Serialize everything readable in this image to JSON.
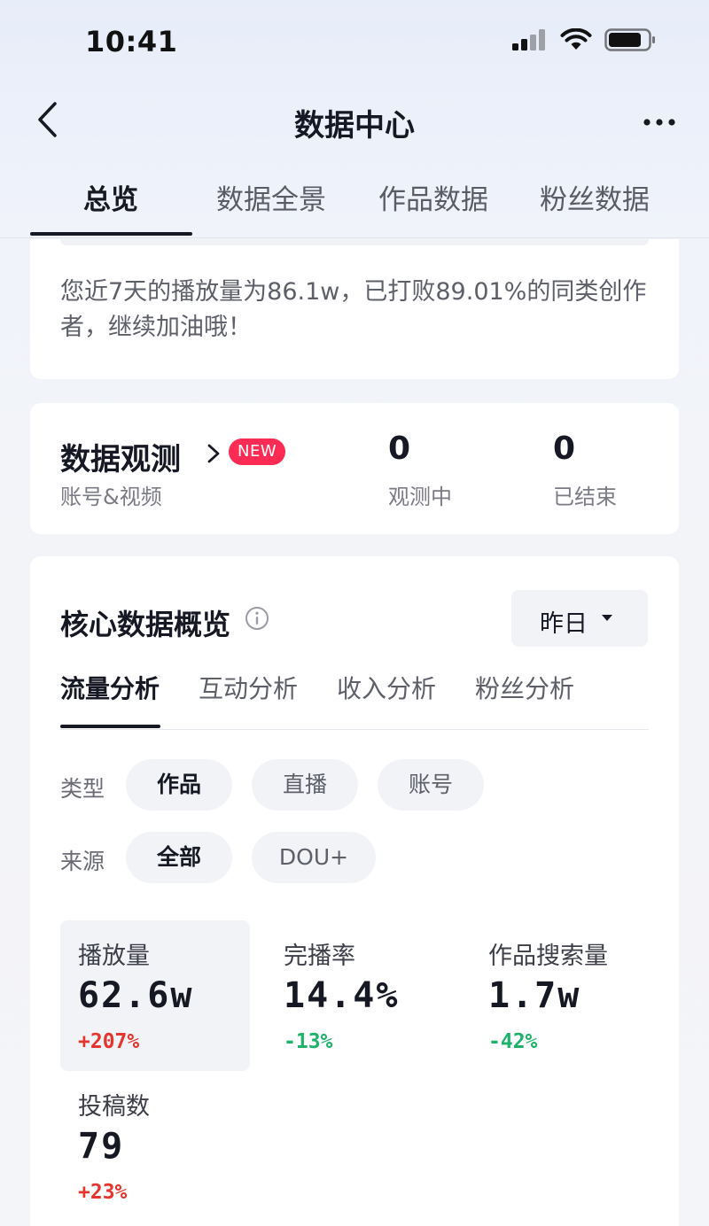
{
  "status_bar": {
    "time": "10:41"
  },
  "nav": {
    "title": "数据中心"
  },
  "tabs": [
    {
      "label": "总览",
      "active": true
    },
    {
      "label": "数据全景",
      "active": false
    },
    {
      "label": "作品数据",
      "active": false
    },
    {
      "label": "粉丝数据",
      "active": false
    }
  ],
  "summary": {
    "text": "您近7天的播放量为86.1w，已打败89.01%的同类创作者，继续加油哦！"
  },
  "observe": {
    "title": "数据观测",
    "badge": "NEW",
    "subtitle": "账号&视频",
    "stats": [
      {
        "value": "0",
        "label": "观测中"
      },
      {
        "value": "0",
        "label": "已结束"
      }
    ]
  },
  "core": {
    "title": "核心数据概览",
    "date_selected": "昨日",
    "sub_tabs": [
      {
        "label": "流量分析",
        "active": true
      },
      {
        "label": "互动分析",
        "active": false
      },
      {
        "label": "收入分析",
        "active": false
      },
      {
        "label": "粉丝分析",
        "active": false
      }
    ],
    "filters": {
      "type": {
        "label": "类型",
        "options": [
          {
            "label": "作品",
            "active": true
          },
          {
            "label": "直播",
            "active": false
          },
          {
            "label": "账号",
            "active": false
          }
        ]
      },
      "source": {
        "label": "来源",
        "options": [
          {
            "label": "全部",
            "active": true
          },
          {
            "label": "DOU+",
            "active": false
          }
        ]
      }
    },
    "metrics": [
      {
        "label": "播放量",
        "value": "62.6w",
        "change": "+207%",
        "trend": "up",
        "selected": true
      },
      {
        "label": "完播率",
        "value": "14.4%",
        "change": "-13%",
        "trend": "down",
        "selected": false
      },
      {
        "label": "作品搜索量",
        "value": "1.7w",
        "change": "-42%",
        "trend": "down",
        "selected": false
      },
      {
        "label": "投稿数",
        "value": "79",
        "change": "+23%",
        "trend": "up",
        "selected": false
      }
    ]
  },
  "colors": {
    "accent_badge": "#fe2c55",
    "up": "#e5352e",
    "down": "#1fb26b",
    "text_primary": "#161823"
  },
  "icons": {
    "back": "chevron-left-icon",
    "more": "more-dots-icon",
    "info": "info-icon",
    "signal": "signal-icon",
    "wifi": "wifi-icon",
    "battery": "battery-icon"
  }
}
